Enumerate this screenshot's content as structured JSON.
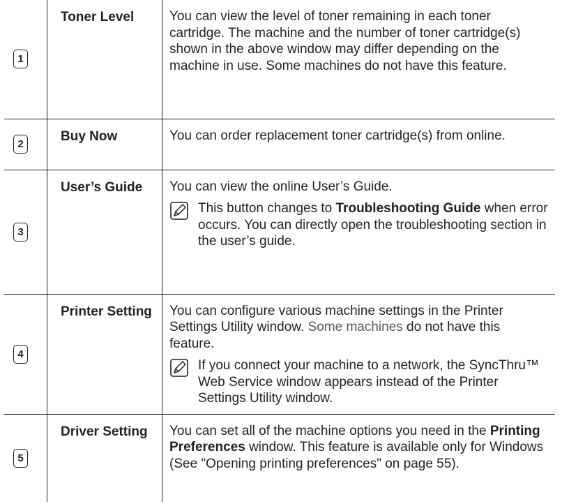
{
  "rows": [
    {
      "number": "1",
      "name": "Toner Level",
      "desc": "You can view the level of toner remaining in each toner cartridge. The machine and the number of toner cartridge(s) shown in the above window may differ depending on the machine in use. Some machines do not have this feature."
    },
    {
      "number": "2",
      "name": "Buy Now",
      "desc": "You can order replacement toner cartridge(s) from online."
    },
    {
      "number": "3",
      "name": "User’s Guide",
      "desc": "You can view the online User’s Guide.",
      "note": {
        "pre": "This button changes to ",
        "bold": "Troubleshooting Guide",
        "post": " when error occurs. You can directly open the troubleshooting section in the user’s guide."
      }
    },
    {
      "number": "4",
      "name": "Printer Setting",
      "desc": "You can configure various machine settings in the Printer Settings Utility window. ",
      "desc_gray": "Some machines",
      "desc_tail": " do not have this feature.",
      "note": {
        "text": "If you connect your machine to a network, the SyncThru™ Web Service window appears instead of the Printer Settings Utility window."
      }
    },
    {
      "number": "5",
      "name": "Driver Setting",
      "desc_pre": "You can set all of the machine options you need in the ",
      "desc_bold": "Printing Preferences",
      "desc_post": " window. This feature is available only for Windows (See \"Opening printing preferences\" on page 55)."
    }
  ],
  "icons": {
    "note": "note-pencil-icon"
  }
}
